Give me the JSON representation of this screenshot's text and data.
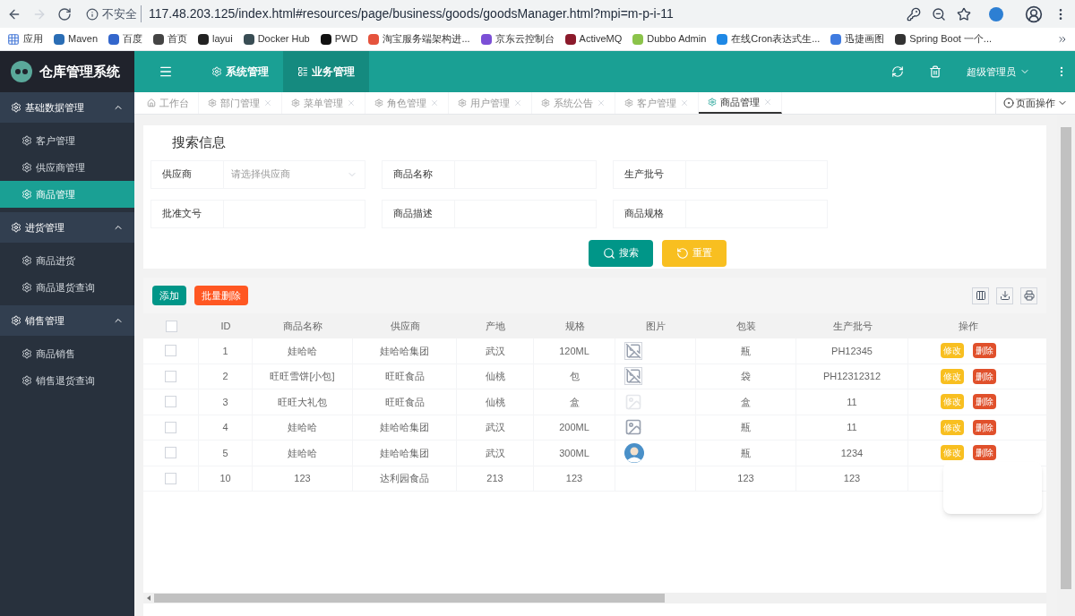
{
  "browser": {
    "security": "不安全",
    "url": "117.48.203.125/index.html#resources/page/business/goods/goodsManager.html?mpi=m-p-i-11",
    "apps_label": "应用",
    "bookmarks": [
      {
        "label": "Maven",
        "color": "#2a6db5"
      },
      {
        "label": "百度",
        "color": "#3366cc"
      },
      {
        "label": "首页",
        "color": "#444444"
      },
      {
        "label": "layui",
        "color": "#222222"
      },
      {
        "label": "Docker Hub",
        "color": "#394d54"
      },
      {
        "label": "PWD",
        "color": "#111111"
      },
      {
        "label": "淘宝服务端架构进...",
        "color": "#e5533d"
      },
      {
        "label": "京东云控制台",
        "color": "#7b4fd6"
      },
      {
        "label": "ActiveMQ",
        "color": "#8b1a2b"
      },
      {
        "label": "Dubbo Admin",
        "color": "#8bc34a"
      },
      {
        "label": "在线Cron表达式生...",
        "color": "#1e88e5"
      },
      {
        "label": "迅捷画图",
        "color": "#3f7be0"
      },
      {
        "label": "Spring Boot 一个...",
        "color": "#333333"
      }
    ]
  },
  "header": {
    "title": "仓库管理系统",
    "nav": [
      {
        "label": "系统管理",
        "selected": false
      },
      {
        "label": "业务管理",
        "selected": true
      }
    ],
    "user": "超级管理员"
  },
  "sidebar": [
    {
      "label": "基础数据管理",
      "expanded": true,
      "children": [
        {
          "label": "客户管理",
          "selected": false
        },
        {
          "label": "供应商管理",
          "selected": false
        },
        {
          "label": "商品管理",
          "selected": true
        }
      ]
    },
    {
      "label": "进货管理",
      "expanded": true,
      "children": [
        {
          "label": "商品进货",
          "selected": false
        },
        {
          "label": "商品退货查询",
          "selected": false
        }
      ]
    },
    {
      "label": "销售管理",
      "expanded": true,
      "children": [
        {
          "label": "商品销售",
          "selected": false
        },
        {
          "label": "销售退货查询",
          "selected": false
        }
      ]
    }
  ],
  "tabs": [
    {
      "label": "工作台",
      "kind": "home",
      "selected": false
    },
    {
      "label": "部门管理",
      "kind": "page",
      "selected": false
    },
    {
      "label": "菜单管理",
      "kind": "page",
      "selected": false
    },
    {
      "label": "角色管理",
      "kind": "page",
      "selected": false
    },
    {
      "label": "用户管理",
      "kind": "page",
      "selected": false
    },
    {
      "label": "系统公告",
      "kind": "page",
      "selected": false
    },
    {
      "label": "客户管理",
      "kind": "page",
      "selected": false
    },
    {
      "label": "商品管理",
      "kind": "page",
      "selected": true
    }
  ],
  "page_ops": "页面操作",
  "search": {
    "title": "搜索信息",
    "fields": [
      {
        "label": "供应商",
        "kind": "select",
        "placeholder": "请选择供应商"
      },
      {
        "label": "商品名称",
        "kind": "text"
      },
      {
        "label": "生产批号",
        "kind": "text"
      },
      {
        "label": "批准文号",
        "kind": "text"
      },
      {
        "label": "商品描述",
        "kind": "text"
      },
      {
        "label": "商品规格",
        "kind": "text"
      }
    ],
    "search_button": "搜索",
    "reset_button": "重置"
  },
  "table": {
    "add_button": "添加",
    "batch_delete_button": "批量删除",
    "header_checked": false,
    "columns": [
      "ID",
      "商品名称",
      "供应商",
      "产地",
      "规格",
      "图片",
      "包装",
      "生产批号",
      "操作"
    ],
    "rows": [
      {
        "checked": false,
        "cells": [
          "1",
          "娃哈哈",
          "娃哈哈集团",
          "武汉",
          "120ML"
        ],
        "image": {
          "kind": "broken"
        },
        "pack": "瓶",
        "batch": "PH12345",
        "actions": [
          "修改",
          "删除"
        ]
      },
      {
        "checked": false,
        "cells": [
          "2",
          "旺旺雪饼[小包]",
          "旺旺食品",
          "仙桃",
          "包"
        ],
        "image": {
          "kind": "broken"
        },
        "pack": "袋",
        "batch": "PH12312312",
        "actions": [
          "修改",
          "删除"
        ]
      },
      {
        "checked": false,
        "cells": [
          "3",
          "旺旺大礼包",
          "旺旺食品",
          "仙桃",
          "盒"
        ],
        "image": {
          "kind": "faint"
        },
        "pack": "盒",
        "batch": "11",
        "actions": [
          "修改",
          "删除"
        ]
      },
      {
        "checked": false,
        "cells": [
          "4",
          "娃哈哈",
          "娃哈哈集团",
          "武汉",
          "200ML"
        ],
        "image": {
          "kind": "placeholder"
        },
        "pack": "瓶",
        "batch": "11",
        "actions": [
          "修改",
          "删除"
        ]
      },
      {
        "checked": false,
        "cells": [
          "5",
          "娃哈哈",
          "娃哈哈集团",
          "武汉",
          "300ML"
        ],
        "image": {
          "kind": "avatar"
        },
        "pack": "瓶",
        "batch": "1234",
        "actions": [
          "修改",
          "删除"
        ]
      },
      {
        "checked": false,
        "cells": [
          "10",
          "123",
          "达利园食品",
          "213",
          "123"
        ],
        "pack": "123",
        "batch": "123"
      }
    ]
  }
}
